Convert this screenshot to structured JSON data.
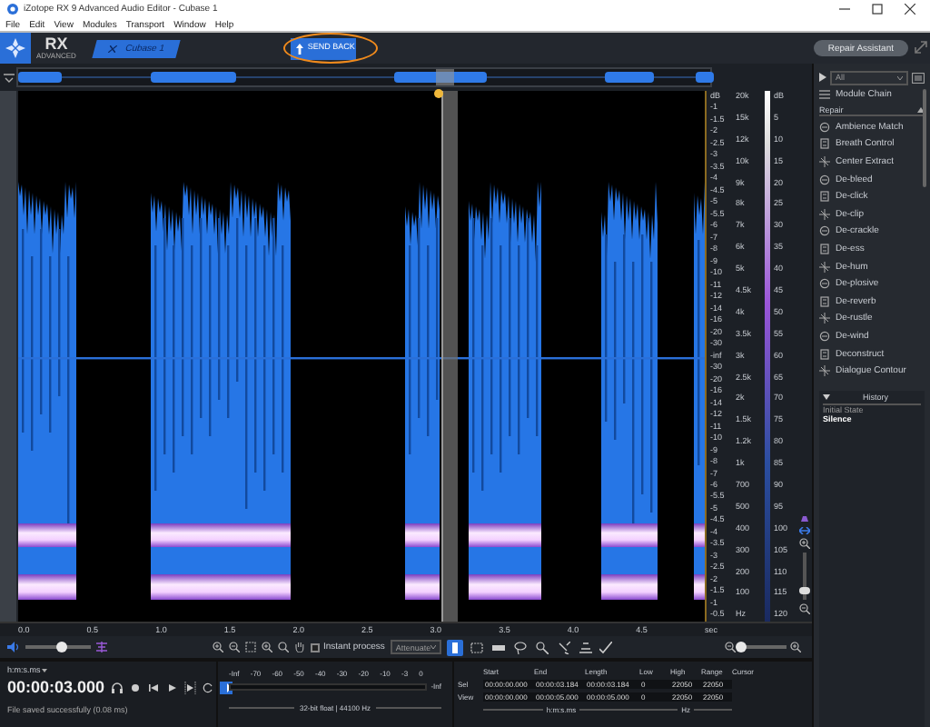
{
  "window": {
    "title": "iZotope RX 9 Advanced Audio Editor - Cubase 1"
  },
  "menu": [
    "File",
    "Edit",
    "View",
    "Modules",
    "Transport",
    "Window",
    "Help"
  ],
  "toolbar": {
    "logo": "RX",
    "logo_sub": "ADVANCED",
    "tabs": [
      {
        "label": "Cubase 1",
        "selected": true
      }
    ],
    "send_back": "SEND BACK",
    "repair_assistant": "Repair Assistant"
  },
  "scales": {
    "db": [
      "dB",
      "-1",
      "-1.5",
      "-2",
      "-2.5",
      "-3",
      "-3.5",
      "-4",
      "-4.5",
      "-5",
      "-5.5",
      "-6",
      "-7",
      "-8",
      "-9",
      "-10",
      "-11",
      "-12",
      "-14",
      "-16",
      "-20",
      "-30",
      "-inf",
      "-30",
      "-20",
      "-16",
      "-14",
      "-12",
      "-11",
      "-10",
      "-9",
      "-8",
      "-7",
      "-6",
      "-5.5",
      "-5",
      "-4.5",
      "-4",
      "-3.5",
      "-3",
      "-2.5",
      "-2",
      "-1.5",
      "-1",
      "-0.5"
    ],
    "freq": [
      "20k",
      "15k",
      "12k",
      "10k",
      "9k",
      "8k",
      "7k",
      "6k",
      "5k",
      "4.5k",
      "4k",
      "3.5k",
      "3k",
      "2.5k",
      "2k",
      "1.5k",
      "1.2k",
      "1k",
      "700",
      "500",
      "400",
      "300",
      "200",
      "100",
      "Hz"
    ],
    "intensity": [
      "dB",
      "5",
      "10",
      "15",
      "20",
      "25",
      "30",
      "35",
      "40",
      "45",
      "50",
      "55",
      "60",
      "65",
      "70",
      "75",
      "80",
      "85",
      "90",
      "95",
      "100",
      "105",
      "110",
      "115",
      "120"
    ],
    "time": [
      "0.0",
      "0.5",
      "1.0",
      "1.5",
      "2.0",
      "2.5",
      "3.0",
      "3.5",
      "4.0",
      "4.5",
      "sec"
    ]
  },
  "tools": {
    "volume": {
      "level": 0.55
    },
    "instant_process": {
      "label": "Instant process",
      "checked": false
    },
    "mode": "Attenuate",
    "selection_tools": [
      {
        "kind": "time",
        "selected": true
      },
      {
        "kind": "time-frequency",
        "selected": false
      },
      {
        "kind": "frequency",
        "selected": false
      },
      {
        "kind": "lasso",
        "selected": false
      },
      {
        "kind": "wand",
        "selected": false
      },
      {
        "kind": "harmonic",
        "selected": false
      },
      {
        "kind": "brush",
        "selected": false
      }
    ],
    "zoom": {
      "level": 0.04
    },
    "vertical_zoom": {
      "level": 0.12
    }
  },
  "transport": {
    "format": "h:m:s.ms",
    "time": "00:00:03.000",
    "buttons": [
      {
        "kind": "monitor",
        "on": false
      },
      {
        "kind": "record",
        "on": false
      },
      {
        "kind": "rewind",
        "on": false
      },
      {
        "kind": "play",
        "on": false
      },
      {
        "kind": "play-selection",
        "on": false
      },
      {
        "kind": "loop",
        "on": false
      },
      {
        "kind": "follow",
        "on": true
      }
    ],
    "status": "File saved successfully (0.08 ms)"
  },
  "meter": {
    "ticks": [
      "-Inf",
      "-70",
      "-60",
      "-50",
      "-40",
      "-30",
      "-20",
      "-10",
      "-3",
      "0"
    ],
    "peak": "-Inf",
    "format": "32-bit float | 44100 Hz"
  },
  "selection": {
    "columns": [
      "Start",
      "End",
      "Length",
      "Low",
      "High",
      "Range",
      "Cursor"
    ],
    "rows": [
      {
        "label": "Sel",
        "cells": [
          "00:00:00.000",
          "00:00:03.184",
          "00:00:03.184",
          "0",
          "22050",
          "22050"
        ]
      },
      {
        "label": "View",
        "cells": [
          "00:00:00.000",
          "00:00:05.000",
          "00:00:05.000",
          "0",
          "22050",
          "22050"
        ]
      }
    ],
    "time_unit": "h:m:s.ms",
    "freq_unit": "Hz"
  },
  "panel": {
    "filter": "All",
    "module_chain": "Module Chain",
    "section": "Repair",
    "expanded": true,
    "modules": [
      "Ambience Match",
      "Breath Control",
      "Center Extract",
      "De-bleed",
      "De-click",
      "De-clip",
      "De-crackle",
      "De-ess",
      "De-hum",
      "De-plosive",
      "De-reverb",
      "De-rustle",
      "De-wind",
      "Deconstruct",
      "Dialogue Contour"
    ],
    "history": {
      "title": "History",
      "expanded": true,
      "items": [
        {
          "label": "Initial State",
          "selected": false
        },
        {
          "label": "Silence",
          "selected": true
        }
      ]
    }
  }
}
